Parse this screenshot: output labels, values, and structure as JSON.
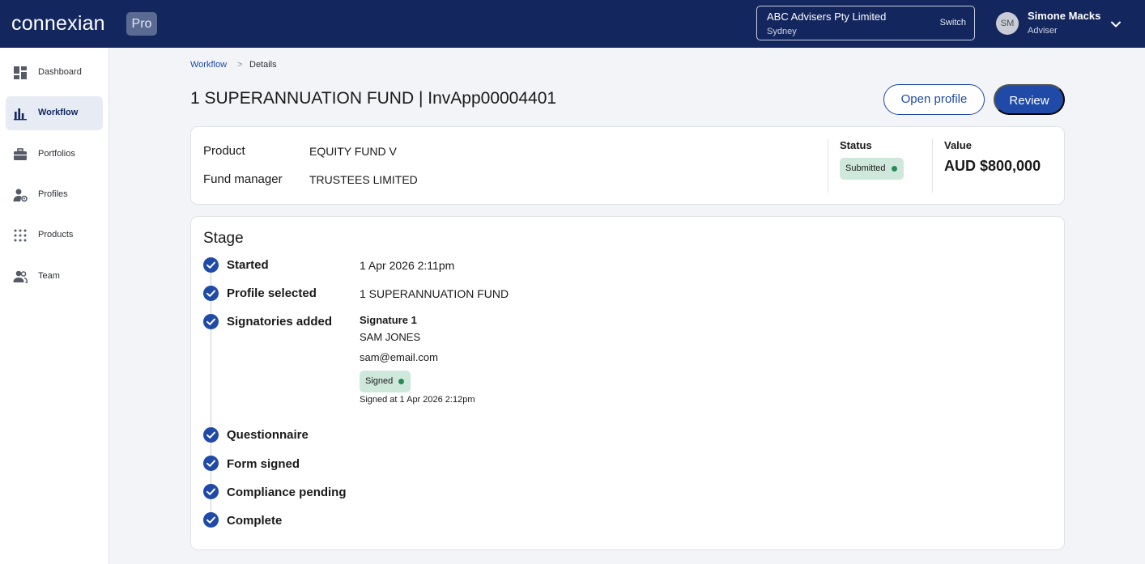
{
  "header": {
    "logo": "connexian",
    "badge": "Pro",
    "org": {
      "name": "ABC Advisers Pty Limited",
      "location": "Sydney",
      "switch_label": "Switch"
    },
    "user": {
      "initials": "SM",
      "name": "Simone Macks",
      "role": "Adviser"
    }
  },
  "sidebar": {
    "items": [
      {
        "label": "Dashboard",
        "icon": "dashboard-icon"
      },
      {
        "label": "Workflow",
        "icon": "bar-chart-icon",
        "active": true
      },
      {
        "label": "Portfolios",
        "icon": "briefcase-icon"
      },
      {
        "label": "Profiles",
        "icon": "person-gear-icon"
      },
      {
        "label": "Products",
        "icon": "grid-dots-icon"
      },
      {
        "label": "Team",
        "icon": "team-icon"
      }
    ]
  },
  "breadcrumb": {
    "parent": "Workflow",
    "separator": ">",
    "current": "Details"
  },
  "page": {
    "title": "1 SUPERANNUATION FUND | InvApp00004401",
    "open_profile_label": "Open profile",
    "review_label": "Review"
  },
  "summary": {
    "product_label": "Product",
    "product_value": "EQUITY FUND V",
    "fund_manager_label": "Fund manager",
    "fund_manager_value": "TRUSTEES LIMITED",
    "status_label": "Status",
    "status_value": "Submitted",
    "value_label": "Value",
    "value_amount": "AUD $800,000"
  },
  "stage": {
    "title": "Stage",
    "steps": [
      {
        "label": "Started",
        "value": "1 Apr 2026 2:11pm"
      },
      {
        "label": "Profile selected",
        "value": "1 SUPERANNUATION FUND"
      },
      {
        "label": "Signatories added",
        "value": ""
      },
      {
        "label": "Questionnaire",
        "value": ""
      },
      {
        "label": "Form signed",
        "value": ""
      },
      {
        "label": "Compliance pending",
        "value": ""
      },
      {
        "label": "Complete",
        "value": ""
      }
    ],
    "signature": {
      "heading": "Signature 1",
      "name": "SAM JONES",
      "email": "sam@email.com",
      "status": "Signed",
      "signed_at": "Signed at 1 Apr 2026 2:12pm"
    }
  },
  "colors": {
    "topbar": "#13265e",
    "accent": "#1f4aa8",
    "badge_green_bg": "#cfe8dc",
    "badge_green_dot": "#2a8a55"
  }
}
